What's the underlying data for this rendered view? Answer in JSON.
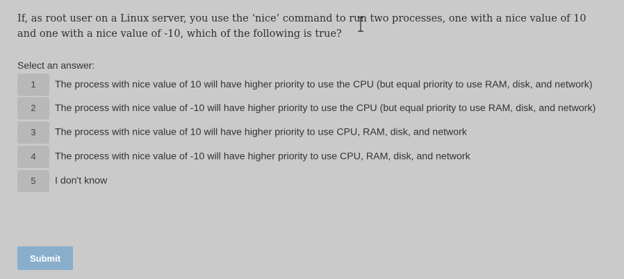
{
  "question": {
    "text": "If, as root user on a Linux server, you use the ‘nice’ command to run two processes, one with a nice value of 10 and one with a nice value of -10, which of the following is true?"
  },
  "prompt_label": "Select an answer:",
  "answers": [
    {
      "number": "1",
      "text": "The process with nice value of 10 will have higher priority to use the CPU (but equal priority to use RAM, disk, and network)"
    },
    {
      "number": "2",
      "text": "The process with nice value of -10 will have higher priority to use the CPU (but equal priority to use RAM, disk, and network)"
    },
    {
      "number": "3",
      "text": "The process with nice value of 10 will have higher priority to use CPU, RAM, disk, and network"
    },
    {
      "number": "4",
      "text": "The process with nice value of -10 will have higher priority to use CPU, RAM, disk, and network"
    },
    {
      "number": "5",
      "text": "I don't know"
    }
  ],
  "submit_label": "Submit",
  "colors": {
    "background": "#cacaca",
    "number_box": "#b8b8b8",
    "submit_button": "#88aecb"
  },
  "cursor_icon": "text-cursor-icon"
}
